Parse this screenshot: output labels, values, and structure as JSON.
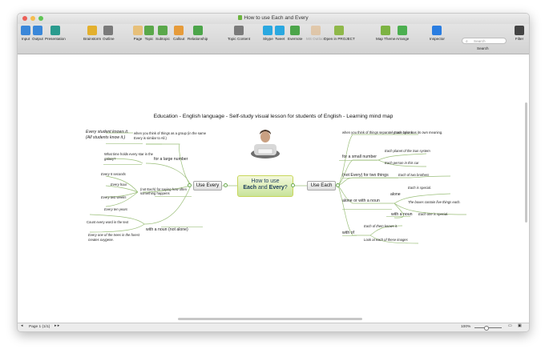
{
  "window": {
    "title": "How to use Each and Every",
    "traffic_lights": [
      "#ec5f57",
      "#f5bd4f",
      "#5fc454"
    ]
  },
  "toolbar": {
    "buttons": [
      {
        "label": "Input",
        "icon": "input-icon",
        "color": "#3a87d9"
      },
      {
        "label": "Output",
        "icon": "output-icon",
        "color": "#3a87d9"
      },
      {
        "label": "Presentation",
        "icon": "presentation-icon",
        "color": "#2a9b8e"
      },
      {
        "label": "Brainstorm",
        "icon": "brainstorm-icon",
        "color": "#e3b02e"
      },
      {
        "label": "Outline",
        "icon": "outline-icon",
        "color": "#7a7a7a"
      },
      {
        "label": "Page",
        "icon": "page-icon",
        "color": "#e7c07a"
      },
      {
        "label": "Topic",
        "icon": "topic-icon",
        "color": "#5aa84a"
      },
      {
        "label": "Subtopic",
        "icon": "subtopic-icon",
        "color": "#5aa84a"
      },
      {
        "label": "Callout",
        "icon": "callout-icon",
        "color": "#e69b3a"
      },
      {
        "label": "Relationship",
        "icon": "relationship-icon",
        "color": "#4ca54a"
      },
      {
        "label": "Topic Content",
        "icon": "topic-content-icon",
        "color": "#7a7a7a"
      },
      {
        "label": "Skype",
        "icon": "skype-icon",
        "color": "#2aa8e0"
      },
      {
        "label": "Tweet",
        "icon": "tweet-icon",
        "color": "#2aa8e0"
      },
      {
        "label": "Evernote",
        "icon": "evernote-icon",
        "color": "#4ca54a"
      },
      {
        "label": "MS Outlook",
        "icon": "ms-outlook-icon",
        "color": "#e0a868",
        "disabled": true
      },
      {
        "label": "Open in PROJECT",
        "icon": "project-icon",
        "color": "#8fb84a"
      },
      {
        "label": "Map Theme",
        "icon": "map-theme-icon",
        "color": "#7cb342"
      },
      {
        "label": "Arrange",
        "icon": "arrange-icon",
        "color": "#4caf50"
      },
      {
        "label": "Inspector",
        "icon": "inspector-icon",
        "color": "#2a7de1"
      },
      {
        "label": "Filter",
        "icon": "filter-icon",
        "color": "#444444"
      }
    ],
    "search": {
      "placeholder": "Search",
      "label": "Search"
    }
  },
  "map": {
    "header": "Education - English language - Self-study visual lesson for students of English - Learning mind map",
    "central_line1": "How to use",
    "central_each": "Each",
    "central_and": " and ",
    "central_every": "Every",
    "central_q": "?",
    "left_main": "Use Every",
    "right_main": "Use Each",
    "left": {
      "note_top_1": "Every student knows it.",
      "note_top_2": "(All students know it.)",
      "when_group_1": "when you think of things as a group (in the same",
      "when_group_2": "Every is similar to All.)",
      "large_number": "for a large number",
      "how_often_1": "(not Each) for saying how often",
      "how_often_2": "something happens",
      "what_time_1": "What time holds every star in the",
      "what_time_2": "galaxy?",
      "ex_seconds": "Every 5 seconds",
      "ex_hour": "Every hour",
      "ex_weeks": "Every two weeks",
      "ex_years": "Every ten years",
      "noun_not_alone": "with a noun (not alone)",
      "count_words": "Count every word in the text",
      "one_trees_1": "Every one of the trees in the forest",
      "one_trees_2": "creates oxygene."
    },
    "right": {
      "top_note": "when you think of things separately, one by one",
      "each_color": "Each color has its own meaning.",
      "small_number": "for a small number",
      "planet": "Each planet of the Sun system",
      "person": "Each person in this car",
      "two_things": "(not Every) for two things",
      "two_brothers": "Each of two brothers",
      "with_or_without": "alone or with a noun",
      "alone": "alone",
      "each_special": "Each is special.",
      "boxes": "The boxes contain five things each.",
      "with_noun": "with a noun",
      "each_one_special": "Each one is special.",
      "with_of": "with of",
      "each_knows": "Each of them knows it.",
      "look_each": "Look at each of these images"
    }
  },
  "status": {
    "page": "Page 1 (1/1)",
    "zoom": "100%"
  }
}
